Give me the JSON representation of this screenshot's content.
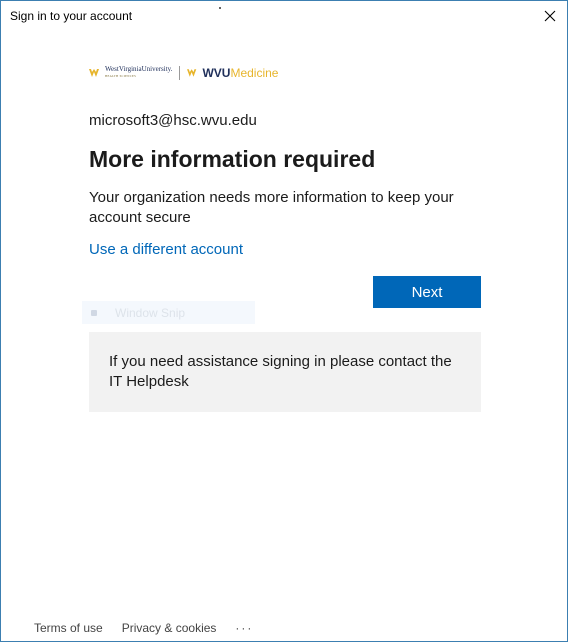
{
  "window": {
    "title": "Sign in to your account"
  },
  "logo": {
    "university": "WestVirginiaUniversity.",
    "university_sub": "HEALTH SCIENCES",
    "brand_bold": "WVU",
    "brand_light": "Medicine"
  },
  "account": {
    "email": "microsoft3@hsc.wvu.edu"
  },
  "main": {
    "heading": "More information required",
    "description": "Your organization needs more information to keep your account secure",
    "different_account_link": "Use a different account",
    "next_button": "Next"
  },
  "overlay": {
    "snip_label": "Window Snip"
  },
  "help": {
    "text": "If you need assistance signing in please contact the IT Helpdesk"
  },
  "footer": {
    "terms": "Terms of use",
    "privacy": "Privacy & cookies",
    "more": "···"
  },
  "colors": {
    "accent": "#0067b8",
    "brand_gold": "#e7b52c",
    "brand_navy": "#1f2f5a"
  }
}
